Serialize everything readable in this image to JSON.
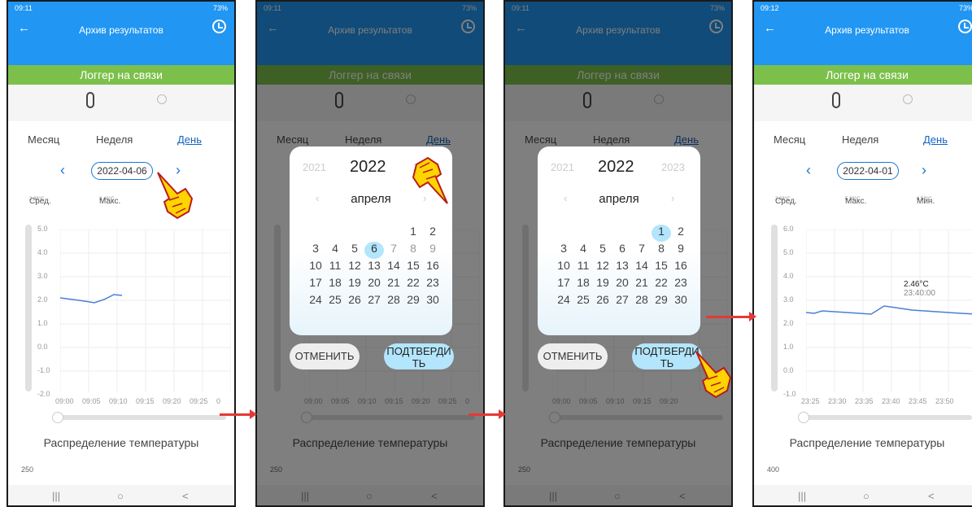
{
  "screens": [
    {
      "status_time": "09:11",
      "battery": "73%",
      "title": "Архив результатов",
      "banner": "Логгер на связи",
      "tabs": [
        "Месяц",
        "Неделя",
        "День"
      ],
      "date": "2022-04-06",
      "stats": {
        "avg": "Сред.",
        "avg_v": "2,36°C",
        "max": "Макс.",
        "max_v": "3,46°C",
        "min_v": "2,69°C"
      },
      "y_ticks": [
        "5.0",
        "4.0",
        "3.0",
        "2.0",
        "1.0",
        "0.0",
        "-1.0",
        "-2.0"
      ],
      "x_ticks": [
        "09:00",
        "09:05",
        "09:10",
        "09:15",
        "09:20",
        "09:25",
        "0"
      ],
      "section": "Распределение температуры",
      "hist_y": "250"
    },
    {
      "status_time": "09:11",
      "battery": "73%",
      "title": "Архив результатов",
      "banner": "Логгер на связи",
      "tabs": [
        "Месяц",
        "Неделя",
        "День"
      ],
      "section": "Распределение температуры",
      "hist_y": "250",
      "x_ticks": [
        "09:00",
        "09:05",
        "09:10",
        "09:15",
        "09:20",
        "09:25",
        "0"
      ]
    },
    {
      "status_time": "09:11",
      "battery": "73%",
      "title": "Архив результатов",
      "banner": "Логгер на связи",
      "tabs": [
        "Месяц",
        "Неделя",
        "День"
      ],
      "section": "Распределение температуры",
      "hist_y": "250",
      "x_ticks": [
        "09:00",
        "09:05",
        "09:10",
        "09:15",
        "09:20"
      ]
    },
    {
      "status_time": "09:12",
      "battery": "73%",
      "title": "Архив результатов",
      "banner": "Логгер на связи",
      "tabs": [
        "Месяц",
        "Неделя",
        "День"
      ],
      "date": "2022-04-01",
      "stats": {
        "avg": "Сред.",
        "avg_v": "2,68°C",
        "max": "Макс.",
        "max_v": "5,28°C",
        "min": "Мин.",
        "min_v": "0,58°C"
      },
      "y_ticks": [
        "6.0",
        "5.0",
        "4.0",
        "3.0",
        "2.0",
        "1.0",
        "0.0",
        "-1.0"
      ],
      "x_ticks": [
        "23:25",
        "23:30",
        "23:35",
        "23:40",
        "23:45",
        "23:50"
      ],
      "tooltip": "2.46°C",
      "tooltip_time": "23:40:00",
      "section": "Распределение температуры",
      "hist_y": "400"
    }
  ],
  "picker": {
    "years": [
      "2021",
      "2022",
      "2023"
    ],
    "month": "апреля",
    "rows": [
      [
        "",
        "",
        "",
        "",
        "",
        "1",
        "2"
      ],
      [
        "3",
        "4",
        "5",
        "6",
        "7",
        "8",
        "9"
      ],
      [
        "10",
        "11",
        "12",
        "13",
        "14",
        "15",
        "16"
      ],
      [
        "17",
        "18",
        "19",
        "20",
        "21",
        "22",
        "23"
      ],
      [
        "24",
        "25",
        "26",
        "27",
        "28",
        "29",
        "30"
      ]
    ],
    "cancel": "ОТМЕНИТЬ",
    "confirm": "ПОДТВЕРДИ\nТЬ"
  },
  "colors": {
    "appbar": "#2196f3",
    "banner": "#7cc04b",
    "accent": "#1976d2",
    "arrow": "#e53935"
  }
}
